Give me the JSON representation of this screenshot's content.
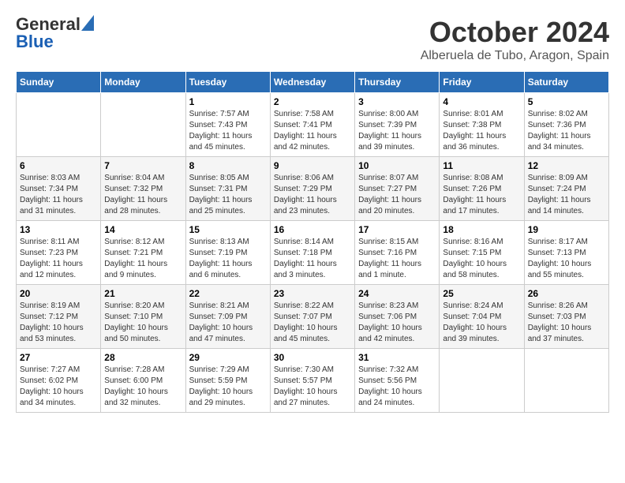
{
  "logo": {
    "general": "General",
    "blue": "Blue"
  },
  "title": "October 2024",
  "location": "Alberuela de Tubo, Aragon, Spain",
  "days_of_week": [
    "Sunday",
    "Monday",
    "Tuesday",
    "Wednesday",
    "Thursday",
    "Friday",
    "Saturday"
  ],
  "weeks": [
    [
      {
        "day": "",
        "info": ""
      },
      {
        "day": "",
        "info": ""
      },
      {
        "day": "1",
        "info": "Sunrise: 7:57 AM\nSunset: 7:43 PM\nDaylight: 11 hours and 45 minutes."
      },
      {
        "day": "2",
        "info": "Sunrise: 7:58 AM\nSunset: 7:41 PM\nDaylight: 11 hours and 42 minutes."
      },
      {
        "day": "3",
        "info": "Sunrise: 8:00 AM\nSunset: 7:39 PM\nDaylight: 11 hours and 39 minutes."
      },
      {
        "day": "4",
        "info": "Sunrise: 8:01 AM\nSunset: 7:38 PM\nDaylight: 11 hours and 36 minutes."
      },
      {
        "day": "5",
        "info": "Sunrise: 8:02 AM\nSunset: 7:36 PM\nDaylight: 11 hours and 34 minutes."
      }
    ],
    [
      {
        "day": "6",
        "info": "Sunrise: 8:03 AM\nSunset: 7:34 PM\nDaylight: 11 hours and 31 minutes."
      },
      {
        "day": "7",
        "info": "Sunrise: 8:04 AM\nSunset: 7:32 PM\nDaylight: 11 hours and 28 minutes."
      },
      {
        "day": "8",
        "info": "Sunrise: 8:05 AM\nSunset: 7:31 PM\nDaylight: 11 hours and 25 minutes."
      },
      {
        "day": "9",
        "info": "Sunrise: 8:06 AM\nSunset: 7:29 PM\nDaylight: 11 hours and 23 minutes."
      },
      {
        "day": "10",
        "info": "Sunrise: 8:07 AM\nSunset: 7:27 PM\nDaylight: 11 hours and 20 minutes."
      },
      {
        "day": "11",
        "info": "Sunrise: 8:08 AM\nSunset: 7:26 PM\nDaylight: 11 hours and 17 minutes."
      },
      {
        "day": "12",
        "info": "Sunrise: 8:09 AM\nSunset: 7:24 PM\nDaylight: 11 hours and 14 minutes."
      }
    ],
    [
      {
        "day": "13",
        "info": "Sunrise: 8:11 AM\nSunset: 7:23 PM\nDaylight: 11 hours and 12 minutes."
      },
      {
        "day": "14",
        "info": "Sunrise: 8:12 AM\nSunset: 7:21 PM\nDaylight: 11 hours and 9 minutes."
      },
      {
        "day": "15",
        "info": "Sunrise: 8:13 AM\nSunset: 7:19 PM\nDaylight: 11 hours and 6 minutes."
      },
      {
        "day": "16",
        "info": "Sunrise: 8:14 AM\nSunset: 7:18 PM\nDaylight: 11 hours and 3 minutes."
      },
      {
        "day": "17",
        "info": "Sunrise: 8:15 AM\nSunset: 7:16 PM\nDaylight: 11 hours and 1 minute."
      },
      {
        "day": "18",
        "info": "Sunrise: 8:16 AM\nSunset: 7:15 PM\nDaylight: 10 hours and 58 minutes."
      },
      {
        "day": "19",
        "info": "Sunrise: 8:17 AM\nSunset: 7:13 PM\nDaylight: 10 hours and 55 minutes."
      }
    ],
    [
      {
        "day": "20",
        "info": "Sunrise: 8:19 AM\nSunset: 7:12 PM\nDaylight: 10 hours and 53 minutes."
      },
      {
        "day": "21",
        "info": "Sunrise: 8:20 AM\nSunset: 7:10 PM\nDaylight: 10 hours and 50 minutes."
      },
      {
        "day": "22",
        "info": "Sunrise: 8:21 AM\nSunset: 7:09 PM\nDaylight: 10 hours and 47 minutes."
      },
      {
        "day": "23",
        "info": "Sunrise: 8:22 AM\nSunset: 7:07 PM\nDaylight: 10 hours and 45 minutes."
      },
      {
        "day": "24",
        "info": "Sunrise: 8:23 AM\nSunset: 7:06 PM\nDaylight: 10 hours and 42 minutes."
      },
      {
        "day": "25",
        "info": "Sunrise: 8:24 AM\nSunset: 7:04 PM\nDaylight: 10 hours and 39 minutes."
      },
      {
        "day": "26",
        "info": "Sunrise: 8:26 AM\nSunset: 7:03 PM\nDaylight: 10 hours and 37 minutes."
      }
    ],
    [
      {
        "day": "27",
        "info": "Sunrise: 7:27 AM\nSunset: 6:02 PM\nDaylight: 10 hours and 34 minutes."
      },
      {
        "day": "28",
        "info": "Sunrise: 7:28 AM\nSunset: 6:00 PM\nDaylight: 10 hours and 32 minutes."
      },
      {
        "day": "29",
        "info": "Sunrise: 7:29 AM\nSunset: 5:59 PM\nDaylight: 10 hours and 29 minutes."
      },
      {
        "day": "30",
        "info": "Sunrise: 7:30 AM\nSunset: 5:57 PM\nDaylight: 10 hours and 27 minutes."
      },
      {
        "day": "31",
        "info": "Sunrise: 7:32 AM\nSunset: 5:56 PM\nDaylight: 10 hours and 24 minutes."
      },
      {
        "day": "",
        "info": ""
      },
      {
        "day": "",
        "info": ""
      }
    ]
  ]
}
